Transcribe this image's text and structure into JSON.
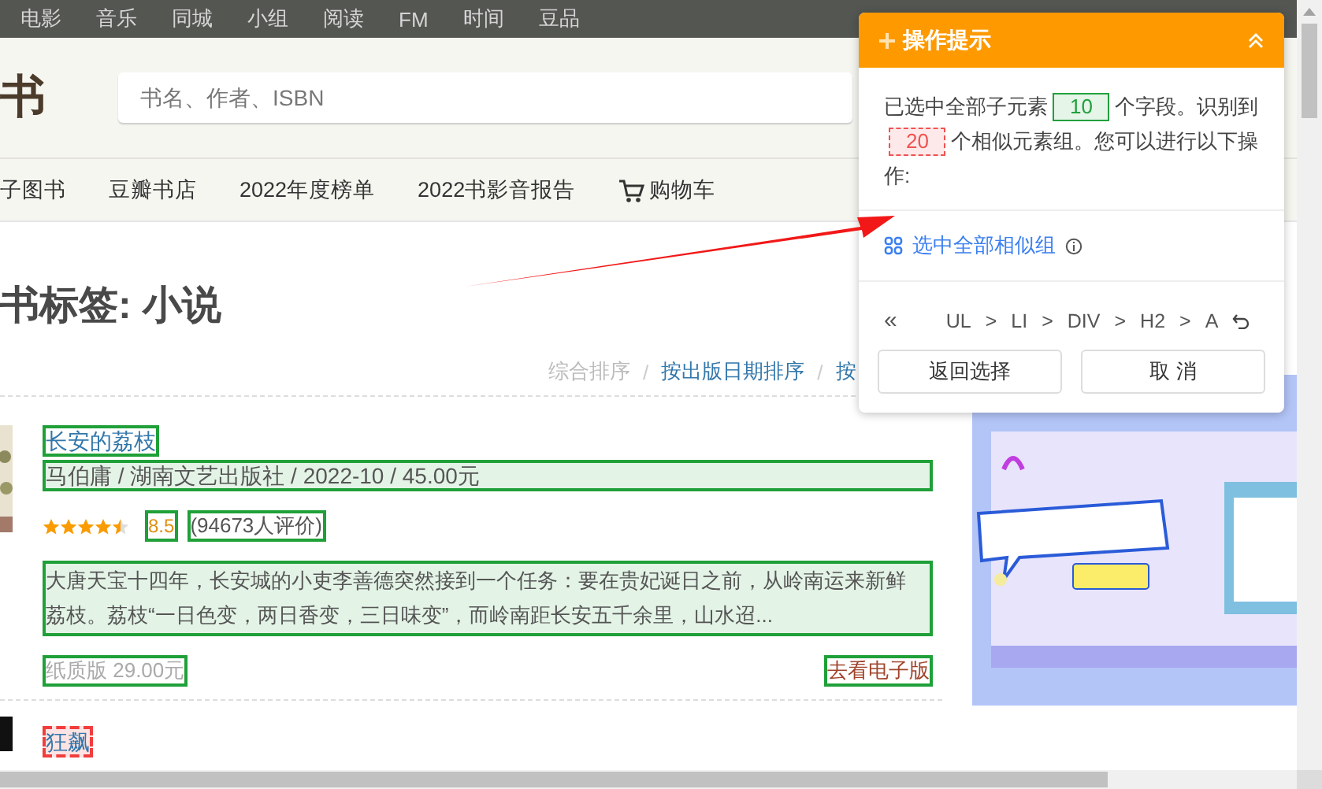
{
  "top_nav": [
    {
      "label": "电影"
    },
    {
      "label": "音乐"
    },
    {
      "label": "同城"
    },
    {
      "label": "小组"
    },
    {
      "label": "阅读"
    },
    {
      "label": "FM"
    },
    {
      "label": "时间"
    },
    {
      "label": "豆品"
    }
  ],
  "logo": "书",
  "search": {
    "placeholder": "书名、作者、ISBN"
  },
  "main_nav": [
    {
      "label": "子图书",
      "kind": "link"
    },
    {
      "label": "豆瓣书店",
      "kind": "link"
    },
    {
      "label": "2022年度榜单",
      "kind": "link"
    },
    {
      "label": "2022书影音报告",
      "kind": "link"
    },
    {
      "label": "购物车",
      "kind": "cart"
    }
  ],
  "heading": "书标签: 小说",
  "sort": {
    "separator": "/",
    "options": [
      {
        "label": "综合排序",
        "selected": true
      },
      {
        "label": "按出版日期排序",
        "selected": false
      },
      {
        "label": "按",
        "selected": false
      }
    ]
  },
  "books": [
    {
      "title": {
        "text": "长安的荔枝",
        "selected": true
      },
      "meta": {
        "text": "马伯庸 / 湖南文艺出版社 / 2022-10 / 45.00元",
        "selected": true
      },
      "stars": 4.5,
      "rating": {
        "text": "8.5",
        "selected": true
      },
      "votes": {
        "text": "(94673人评价)",
        "selected": true
      },
      "summary": {
        "text": "大唐天宝十四年，长安城的小吏李善德突然接到一个任务：要在贵妃诞日之前，从岭南运来新鲜荔枝。荔枝“一日色变，两日香变，三日味变”，而岭南距长安五千余里，山水迢...",
        "selected": true
      },
      "paper_price": {
        "text": "纸质版 29.00元",
        "selected": true
      },
      "ebook_link": {
        "text": "去看电子版",
        "selected": true
      }
    },
    {
      "title": {
        "text": "狂飙",
        "selected": false
      }
    }
  ],
  "panel": {
    "title": "操作提示",
    "message": [
      {
        "kind": "text",
        "text": "已选中全部子元素"
      },
      {
        "kind": "field-count",
        "text": "10"
      },
      {
        "kind": "text",
        "text": "个字段。识别到"
      },
      {
        "kind": "similar-count",
        "text": "20"
      },
      {
        "kind": "text",
        "text": "个相似元素组。您可以进行以下操"
      },
      {
        "kind": "text",
        "text": "作:"
      }
    ],
    "action": {
      "label": "选中全部相似组"
    },
    "breadcrumb": {
      "back": "«",
      "separator": ">",
      "items": [
        "UL",
        "LI",
        "DIV",
        "H2",
        "A"
      ]
    },
    "buttons": [
      "返回选择",
      "取 消"
    ]
  }
}
